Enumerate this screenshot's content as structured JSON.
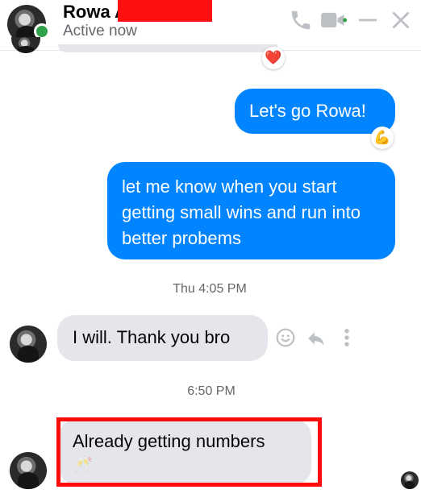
{
  "header": {
    "name": "Rowa A",
    "status": "Active now",
    "icons": [
      "phone-icon",
      "video-icon",
      "minimize-icon",
      "close-icon"
    ]
  },
  "messages": {
    "sent_1": "Let's go Rowa!",
    "sent_1_reaction": "💪",
    "sent_2": "let me know when you start getting small wins and run into better probems",
    "timestamp_1": "Thu 4:05 PM",
    "received_1": "I will. Thank you bro",
    "timestamp_2": "6:50 PM",
    "received_2": "Already getting numbers",
    "received_2_emoji": "🥂",
    "prev_reaction": "❤️"
  },
  "colors": {
    "accent": "#0084ff",
    "incoming_bubble": "#e4e6eb",
    "online": "#31a24c",
    "highlight": "#ff0a0a"
  }
}
